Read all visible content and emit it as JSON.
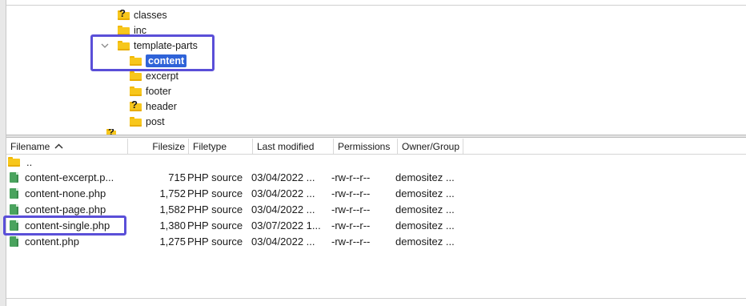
{
  "tree": {
    "items": [
      {
        "label": "classes",
        "icon": "unknown-folder-icon"
      },
      {
        "label": "inc",
        "icon": "folder-icon"
      },
      {
        "label": "template-parts",
        "icon": "folder-icon",
        "expanded": true
      },
      {
        "label": "content",
        "icon": "folder-icon",
        "selected": true
      },
      {
        "label": "excerpt",
        "icon": "folder-icon"
      },
      {
        "label": "footer",
        "icon": "folder-icon"
      },
      {
        "label": "header",
        "icon": "unknown-folder-icon"
      },
      {
        "label": "post",
        "icon": "folder-icon"
      }
    ]
  },
  "file_list": {
    "columns": {
      "filename": "Filename",
      "filesize": "Filesize",
      "filetype": "Filetype",
      "last_modified": "Last modified",
      "permissions": "Permissions",
      "owner_group": "Owner/Group"
    },
    "sort": {
      "column": "Filename",
      "direction": "ascending"
    },
    "parent_dir": {
      "name": ".."
    },
    "rows": [
      {
        "name": "content-excerpt.p...",
        "size": "715",
        "type": "PHP source",
        "modified": "03/04/2022 ...",
        "perms": "-rw-r--r--",
        "owner": "demositez ..."
      },
      {
        "name": "content-none.php",
        "size": "1,752",
        "type": "PHP source",
        "modified": "03/04/2022 ...",
        "perms": "-rw-r--r--",
        "owner": "demositez ..."
      },
      {
        "name": "content-page.php",
        "size": "1,582",
        "type": "PHP source",
        "modified": "03/04/2022 ...",
        "perms": "-rw-r--r--",
        "owner": "demositez ..."
      },
      {
        "name": "content-single.php",
        "size": "1,380",
        "type": "PHP source",
        "modified": "03/07/2022 1...",
        "perms": "-rw-r--r--",
        "owner": "demositez ..."
      },
      {
        "name": "content.php",
        "size": "1,275",
        "type": "PHP source",
        "modified": "03/04/2022 ...",
        "perms": "-rw-r--r--",
        "owner": "demositez ..."
      }
    ]
  },
  "colors": {
    "selection": "#2f63d8",
    "annotation": "#5a4fd8",
    "folder": "#f7c71c",
    "php_file": "#4aa35e"
  }
}
